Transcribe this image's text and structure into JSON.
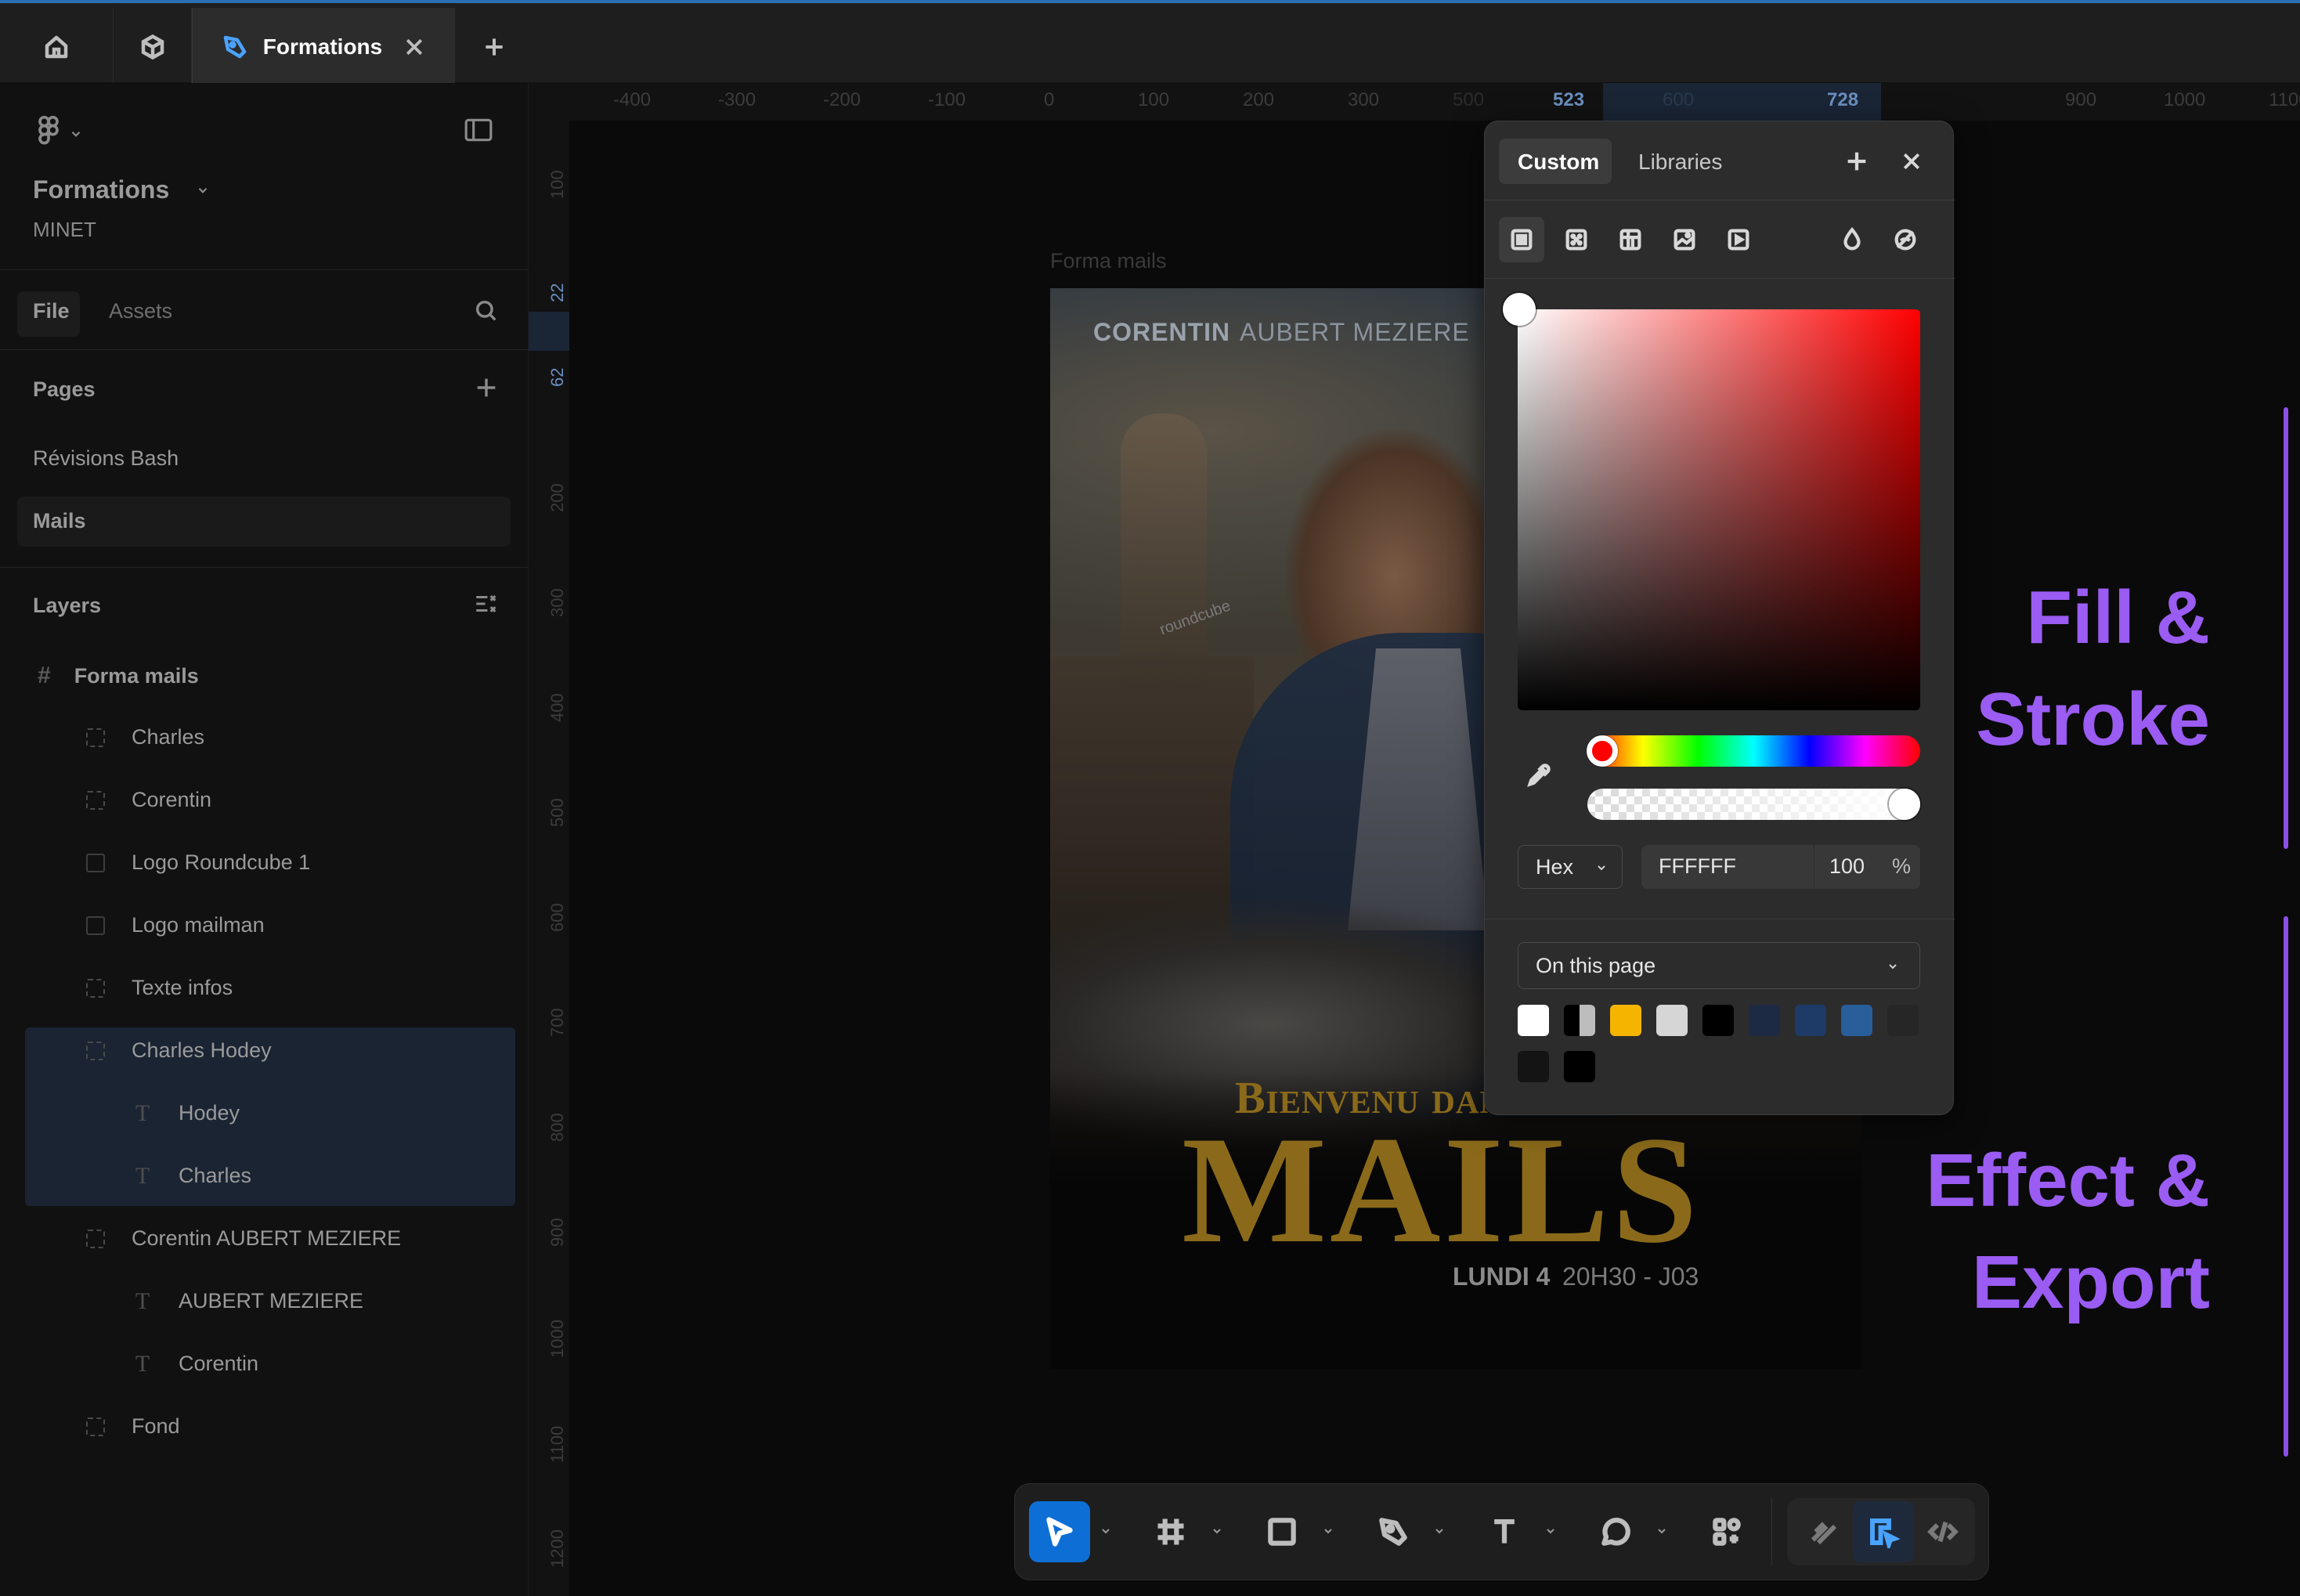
{
  "tabs": {
    "home": "home-icon",
    "plugins": "plugin-icon",
    "active_label": "Formations"
  },
  "sidebar": {
    "file_name": "Formations",
    "team_name": "MINET",
    "file_tab": "File",
    "assets_tab": "Assets",
    "pages_title": "Pages",
    "pages": [
      "Révisions Bash",
      "Mails"
    ],
    "layers_title": "Layers",
    "layers": [
      {
        "name": "Forma mails",
        "type": "frame"
      },
      {
        "name": "Charles",
        "type": "group"
      },
      {
        "name": "Corentin",
        "type": "group"
      },
      {
        "name": "Logo Roundcube 1",
        "type": "image"
      },
      {
        "name": "Logo mailman",
        "type": "image"
      },
      {
        "name": "Texte infos",
        "type": "group"
      },
      {
        "name": "Charles Hodey",
        "type": "group"
      },
      {
        "name": "Hodey",
        "type": "text"
      },
      {
        "name": "Charles",
        "type": "text"
      },
      {
        "name": "Corentin AUBERT MEZIERE",
        "type": "group"
      },
      {
        "name": "AUBERT MEZIERE",
        "type": "text"
      },
      {
        "name": "Corentin",
        "type": "text"
      },
      {
        "name": "Fond",
        "type": "group"
      }
    ]
  },
  "rulers": {
    "top": [
      "-400",
      "-300",
      "-200",
      "-100",
      "0",
      "100",
      "200",
      "300",
      "500",
      "523",
      "600",
      "728",
      "900",
      "1000",
      "1100"
    ],
    "left": [
      "100",
      "22",
      "62",
      "200",
      "300",
      "400",
      "500",
      "600",
      "700",
      "800",
      "900",
      "1000",
      "1100",
      "1200"
    ]
  },
  "canvas": {
    "frame_label": "Forma mails",
    "poster": {
      "name_first": "CORENTIN",
      "name_last": "AUBERT MEZIERE",
      "brand": "roundcube",
      "subtitle": "Bienvenu dans vos",
      "title": "MAILS",
      "date": "LUNDI 4",
      "time": "20H30 - J03"
    }
  },
  "color_picker": {
    "tab_custom": "Custom",
    "tab_libraries": "Libraries",
    "format": "Hex",
    "hex_value": "FFFFFF",
    "opacity": "100",
    "opacity_unit": "%",
    "scope": "On this page",
    "hue_color": "#ff0000",
    "swatches": [
      "#ffffff",
      "#1a1a1a",
      "#f5b400",
      "#d6d6d6",
      "#000000",
      "#1d2a44",
      "#1e3a66",
      "#285e9a",
      "#262626",
      "#141414",
      "#000000"
    ]
  },
  "toolbar": {
    "tools": [
      "move-tool",
      "frame-tool",
      "shape-tool",
      "pen-tool",
      "text-tool",
      "comment-tool",
      "actions-tool"
    ],
    "modes": [
      "draw-mode",
      "design-mode",
      "dev-mode"
    ]
  },
  "annotations": {
    "fill_stroke_line1": "Fill &",
    "fill_stroke_line2": "Stroke",
    "effect_export_line1": "Effect &",
    "effect_export_line2": "Export"
  }
}
